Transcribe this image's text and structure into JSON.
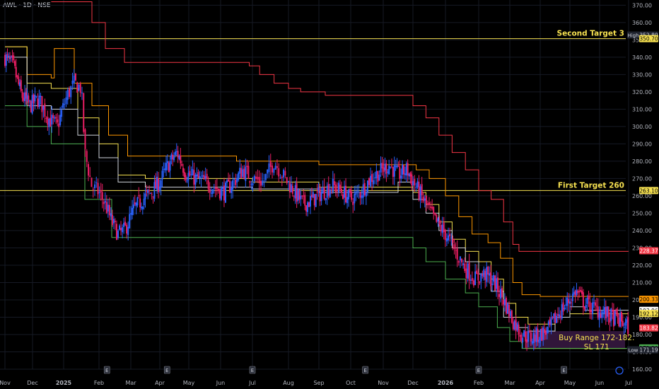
{
  "header": {
    "ticker": "AWL · 1D · NSE"
  },
  "chart_data": {
    "type": "candlestick",
    "ylim": [
      160,
      373
    ],
    "y_ticks": [
      160,
      170,
      180,
      190,
      200,
      210,
      220,
      230,
      240,
      250,
      260,
      270,
      280,
      290,
      300,
      310,
      320,
      330,
      340,
      350,
      360,
      370
    ],
    "x_labels": [
      "Nov",
      "Dec",
      "2025",
      "Feb",
      "Mar",
      "Apr",
      "May",
      "Jun",
      "Jul",
      "Aug",
      "Sep",
      "Oct",
      "Nov",
      "Dec",
      "2026",
      "Feb",
      "Mar",
      "Apr",
      "May",
      "Jun",
      "Jul"
    ],
    "x_label_pos": [
      0,
      1,
      2,
      3,
      4,
      5,
      6,
      7,
      8,
      9,
      10,
      11,
      12,
      13,
      14,
      15,
      16,
      17,
      18,
      19,
      20
    ],
    "earnings_markers": [
      "E",
      "E",
      "E",
      "E",
      "E",
      "E"
    ],
    "close_path": [
      [
        0,
        340
      ],
      [
        0.3,
        335
      ],
      [
        0.6,
        318
      ],
      [
        0.9,
        312
      ],
      [
        1.2,
        316
      ],
      [
        1.5,
        305
      ],
      [
        1.8,
        300
      ],
      [
        2.1,
        318
      ],
      [
        2.3,
        325
      ],
      [
        2.5,
        322
      ],
      [
        2.6,
        285
      ],
      [
        2.8,
        265
      ],
      [
        3.0,
        262
      ],
      [
        3.2,
        255
      ],
      [
        3.4,
        245
      ],
      [
        3.6,
        238
      ],
      [
        3.8,
        240
      ],
      [
        4.1,
        252
      ],
      [
        4.4,
        258
      ],
      [
        4.7,
        262
      ],
      [
        5.0,
        268
      ],
      [
        5.3,
        278
      ],
      [
        5.6,
        285
      ],
      [
        5.9,
        273
      ],
      [
        6.2,
        270
      ],
      [
        6.5,
        268
      ],
      [
        6.8,
        265
      ],
      [
        7.1,
        262
      ],
      [
        7.4,
        268
      ],
      [
        7.7,
        275
      ],
      [
        8.0,
        270
      ],
      [
        8.3,
        268
      ],
      [
        8.6,
        280
      ],
      [
        8.9,
        270
      ],
      [
        9.2,
        262
      ],
      [
        9.5,
        255
      ],
      [
        9.8,
        258
      ],
      [
        10.1,
        262
      ],
      [
        10.4,
        266
      ],
      [
        10.7,
        263
      ],
      [
        11.0,
        258
      ],
      [
        11.3,
        262
      ],
      [
        11.6,
        270
      ],
      [
        11.9,
        274
      ],
      [
        12.2,
        278
      ],
      [
        12.5,
        272
      ],
      [
        12.8,
        275
      ],
      [
        13.1,
        265
      ],
      [
        13.4,
        255
      ],
      [
        13.7,
        245
      ],
      [
        14.0,
        238
      ],
      [
        14.3,
        228
      ],
      [
        14.6,
        218
      ],
      [
        14.9,
        212
      ],
      [
        15.2,
        215
      ],
      [
        15.5,
        210
      ],
      [
        15.8,
        200
      ],
      [
        16.1,
        188
      ],
      [
        16.4,
        180
      ],
      [
        16.7,
        178
      ],
      [
        17.0,
        180
      ],
      [
        17.3,
        183
      ],
      [
        17.6,
        192
      ],
      [
        17.9,
        198
      ],
      [
        18.2,
        205
      ],
      [
        18.5,
        198
      ],
      [
        18.8,
        195
      ],
      [
        19.1,
        193
      ],
      [
        19.4,
        190
      ],
      [
        19.7,
        188
      ],
      [
        20.0,
        184
      ]
    ],
    "bands": [
      {
        "color": "#f23645",
        "pts": [
          [
            1.6,
            372
          ],
          [
            2.2,
            372
          ],
          [
            2.8,
            360
          ],
          [
            3.2,
            345
          ],
          [
            3.8,
            337
          ],
          [
            5.5,
            337
          ],
          [
            7.5,
            337
          ],
          [
            7.9,
            335
          ],
          [
            8.2,
            330
          ],
          [
            8.6,
            325
          ],
          [
            9.0,
            322
          ],
          [
            9.4,
            320
          ],
          [
            10.2,
            318
          ],
          [
            11.5,
            318
          ],
          [
            12.8,
            318
          ],
          [
            13.0,
            312
          ],
          [
            13.4,
            305
          ],
          [
            13.8,
            295
          ],
          [
            14.2,
            285
          ],
          [
            14.6,
            275
          ],
          [
            15.0,
            263
          ],
          [
            15.4,
            258
          ],
          [
            15.8,
            245
          ],
          [
            16.1,
            232
          ],
          [
            16.3,
            228
          ],
          [
            20.0,
            228
          ]
        ]
      },
      {
        "color": "#ff9800",
        "pts": [
          [
            0,
            346
          ],
          [
            0.7,
            346
          ],
          [
            0.8,
            330
          ],
          [
            1.3,
            330
          ],
          [
            1.6,
            328
          ],
          [
            1.7,
            345
          ],
          [
            2.3,
            325
          ],
          [
            2.8,
            312
          ],
          [
            3.3,
            295
          ],
          [
            3.9,
            283
          ],
          [
            5.0,
            283
          ],
          [
            5.6,
            283
          ],
          [
            7.5,
            280
          ],
          [
            10.0,
            278
          ],
          [
            12.0,
            278
          ],
          [
            12.8,
            278
          ],
          [
            13.1,
            275
          ],
          [
            13.5,
            270
          ],
          [
            14.0,
            260
          ],
          [
            14.4,
            248
          ],
          [
            14.8,
            238
          ],
          [
            15.3,
            233
          ],
          [
            15.7,
            224
          ],
          [
            16.1,
            210
          ],
          [
            16.4,
            203
          ],
          [
            17.0,
            202
          ],
          [
            20.0,
            202
          ]
        ]
      },
      {
        "color": "#f5e050",
        "pts": [
          [
            0,
            346
          ],
          [
            0.7,
            346
          ],
          [
            0.8,
            325
          ],
          [
            1.6,
            322
          ],
          [
            1.8,
            322
          ],
          [
            2.4,
            305
          ],
          [
            3.0,
            290
          ],
          [
            3.6,
            272
          ],
          [
            4.5,
            270
          ],
          [
            6.0,
            270
          ],
          [
            8.0,
            268
          ],
          [
            10.0,
            265
          ],
          [
            12.5,
            265
          ],
          [
            13.0,
            262
          ],
          [
            13.4,
            255
          ],
          [
            13.8,
            245
          ],
          [
            14.2,
            235
          ],
          [
            14.6,
            228
          ],
          [
            15.0,
            222
          ],
          [
            15.4,
            212
          ],
          [
            15.8,
            198
          ],
          [
            16.2,
            190
          ],
          [
            16.6,
            186
          ],
          [
            17.5,
            190
          ],
          [
            18.0,
            192
          ],
          [
            18.5,
            192
          ],
          [
            20.0,
            192
          ]
        ]
      },
      {
        "color": "#d1d4dc",
        "pts": [
          [
            0,
            340
          ],
          [
            0.7,
            340
          ],
          [
            0.8,
            312
          ],
          [
            1.6,
            310
          ],
          [
            1.8,
            310
          ],
          [
            2.4,
            295
          ],
          [
            3.0,
            282
          ],
          [
            3.6,
            268
          ],
          [
            4.5,
            265
          ],
          [
            6.0,
            265
          ],
          [
            8.0,
            264
          ],
          [
            10.0,
            262
          ],
          [
            12.5,
            268
          ],
          [
            13.0,
            258
          ],
          [
            13.4,
            250
          ],
          [
            13.8,
            240
          ],
          [
            14.2,
            230
          ],
          [
            14.6,
            222
          ],
          [
            15.0,
            215
          ],
          [
            15.4,
            205
          ],
          [
            15.8,
            190
          ],
          [
            16.2,
            184
          ],
          [
            16.6,
            182
          ],
          [
            17.5,
            190
          ],
          [
            18.0,
            196
          ],
          [
            18.5,
            194
          ],
          [
            20.0,
            194
          ]
        ]
      },
      {
        "color": "#4caf50",
        "pts": [
          [
            0,
            312
          ],
          [
            0.7,
            312
          ],
          [
            0.8,
            300
          ],
          [
            1.6,
            290
          ],
          [
            2.6,
            258
          ],
          [
            3.4,
            236
          ],
          [
            10.0,
            236
          ],
          [
            12.5,
            236
          ],
          [
            13.0,
            230
          ],
          [
            13.4,
            222
          ],
          [
            14.0,
            212
          ],
          [
            14.6,
            204
          ],
          [
            15.0,
            196
          ],
          [
            15.6,
            184
          ],
          [
            16.0,
            176
          ],
          [
            16.4,
            172
          ],
          [
            20.0,
            172
          ]
        ]
      }
    ],
    "hlines": [
      {
        "value": 350.7,
        "color": "#f5e050",
        "label": "Second Target 3"
      },
      {
        "value": 263.1,
        "color": "#f5e050",
        "label": "First Target 260"
      }
    ],
    "buy_zone": {
      "from": 172,
      "to": 182,
      "color": "#3a1a44",
      "x_start": 16.5,
      "label_line1": "Buy Range 172-182.",
      "label_line2": "SL  171"
    },
    "price_tags": [
      {
        "value": 352.8,
        "text": "352.80",
        "bg": "#1e222d",
        "fg": "#d1d4dc",
        "prefix": "High"
      },
      {
        "value": 350.7,
        "text": "350.70",
        "bg": "#f5e050",
        "fg": "#000000",
        "prefix": ""
      },
      {
        "value": 263.1,
        "text": "263.10",
        "bg": "#f5e050",
        "fg": "#000000",
        "prefix": ""
      },
      {
        "value": 228.37,
        "text": "228.37",
        "bg": "#f23645",
        "fg": "#ffffff",
        "prefix": ""
      },
      {
        "value": 200.33,
        "text": "200.33",
        "bg": "#ff9800",
        "fg": "#000000",
        "prefix": ""
      },
      {
        "value": 193.96,
        "text": "193.96",
        "bg": "#ffffff",
        "fg": "#000000",
        "prefix": ""
      },
      {
        "value": 192.12,
        "text": "192.12",
        "bg": "#f5e050",
        "fg": "#000000",
        "prefix": ""
      },
      {
        "value": 183.82,
        "text": "183.82",
        "bg": "#f23645",
        "fg": "#ffffff",
        "prefix": ""
      },
      {
        "value": 172.3,
        "text": "172.30",
        "bg": "#4caf50",
        "fg": "#000000",
        "prefix": ""
      },
      {
        "value": 171.19,
        "text": "171.19",
        "bg": "#1e222d",
        "fg": "#d1d4dc",
        "prefix": "Low"
      }
    ],
    "colors": {
      "up": "#2962ff",
      "down": "#e91e63",
      "grid": "#161a25",
      "axis_text": "#b2b5be"
    }
  }
}
